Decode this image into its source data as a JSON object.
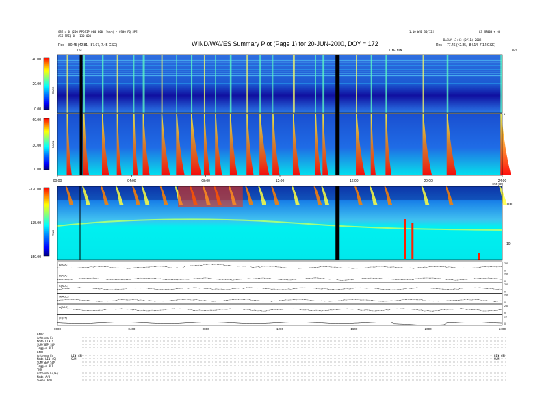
{
  "header": {
    "title": "WIND/WAVES Summary Plot (Page 1) for 20-JUN-2000, DOY = 172",
    "left_line1": "GSE = 0 (200 RPOSIP 000 000 (Yes%) - 0700 FQ SPE",
    "left_line2": "ASI FREQ 0 + 130 000",
    "left_line3_label": "Res",
    "left_line3_value": "80.45 (42.81, -87.67, 7.45 GSE)",
    "right_line1": "1.10 WSD 30/122",
    "right_line2": "DAILY 17:03 (0/11) 2002",
    "right_line3_label": "Res",
    "right_line3_value": "77.46 (42.85, -84.14, 7.12 GSE)",
    "far_right": "L3 MR000 + 00",
    "cal_label": "Cal",
    "freq_top_label": "TIME MIN",
    "freq_top_right": "kHz",
    "rad2_freq_right": "1"
  },
  "panels": {
    "rad2": {
      "label": "RAD2",
      "ticks": [
        "40.00",
        "20.00",
        "0.00"
      ],
      "color_top": "#c00000"
    },
    "rad1": {
      "label": "RAD1",
      "ticks": [
        "60.00",
        "30.00",
        "0.00"
      ],
      "color_top": "#c00000"
    },
    "tnr": {
      "label": "TNR",
      "ticks": [
        "-120.00",
        "-135.00",
        "-150.00"
      ],
      "right_ticks": [
        "100",
        "10"
      ],
      "top_right": "kHz (dB)"
    }
  },
  "time_axis": {
    "labels": [
      "00:00",
      "04:00",
      "08:00",
      "12:00",
      "16:00",
      "20:00",
      "24:00"
    ]
  },
  "bottom_time_axis": {
    "labels": [
      "0000",
      "0400",
      "0800",
      "1200",
      "1600",
      "2000",
      "2400"
    ]
  },
  "params": [
    {
      "label": "B(ADC)",
      "scale_top": "250",
      "scale_bot": "0"
    },
    {
      "label": "B(ADC)",
      "scale_top": "250",
      "scale_bot": "0"
    },
    {
      "label": "C(ADC)",
      "scale_top": "250",
      "scale_bot": "0"
    },
    {
      "label": "M(ADC)",
      "scale_top": "250",
      "scale_bot": "0"
    },
    {
      "label": "A(ADC)",
      "scale_top": "250",
      "scale_bot": "0"
    },
    {
      "label": "|B|(nT)",
      "scale_top": "20",
      "scale_bot": "0"
    }
  ],
  "footer": {
    "rad2": {
      "name": "RAD2",
      "rows": [
        [
          "Antenna",
          "Ex"
        ],
        [
          "Mode",
          "LIN S"
        ],
        [
          "SUM/SEP",
          "SUM"
        ],
        [
          "Toggle",
          "OFF"
        ]
      ]
    },
    "rad1": {
      "name": "RAD1",
      "rows": [
        [
          "Antenna",
          "Ex"
        ],
        [
          "Mode",
          "LIN (S)"
        ],
        [
          "SUM/SEP",
          "SUM"
        ],
        [
          "Toggle",
          "OFF"
        ]
      ],
      "mid1": "LIN (S)",
      "mid2": "SUM",
      "right1": "LIN (S)",
      "right2": "SUM"
    },
    "tnr": {
      "name": "TNR",
      "rows": [
        [
          "Antenna",
          "Ex/Ey"
        ],
        [
          "Mode",
          "A/D"
        ],
        [
          "Sweep",
          "A/D"
        ]
      ]
    }
  },
  "chart_data": {
    "type": "heatmap",
    "title": "WIND/WAVES Summary Plot (Page 1) for 20-JUN-2000, DOY = 172",
    "x": {
      "unit": "UT hours",
      "range": [
        0,
        24
      ]
    },
    "data_gaps_hours": [
      1.2,
      15.0
    ],
    "type_iii_bursts_hours": [
      0.5,
      1.4,
      2.4,
      3.2,
      4.1,
      4.6,
      5.6,
      6.4,
      7.2,
      7.9,
      8.5,
      9.3,
      10.2,
      10.9,
      11.6,
      12.7,
      13.9,
      14.3,
      16.1,
      16.9,
      17.7,
      19.7,
      21.0,
      23.9
    ],
    "rad2": {
      "ylabel": "RAD2",
      "ylim": [
        0,
        40
      ],
      "ticks": [
        0,
        20,
        40
      ]
    },
    "rad1": {
      "ylabel": "RAD1",
      "ylim": [
        0,
        60
      ],
      "ticks": [
        0,
        30,
        60
      ]
    },
    "tnr": {
      "ylabel": "TNR",
      "ylim": [
        -150,
        -120
      ],
      "ticks": [
        -150,
        -135,
        -120
      ]
    },
    "colorscale": [
      "#000080",
      "#0000ff",
      "#0080ff",
      "#00ffff",
      "#80ff80",
      "#ffff00",
      "#ff8000",
      "#ff0000"
    ]
  }
}
